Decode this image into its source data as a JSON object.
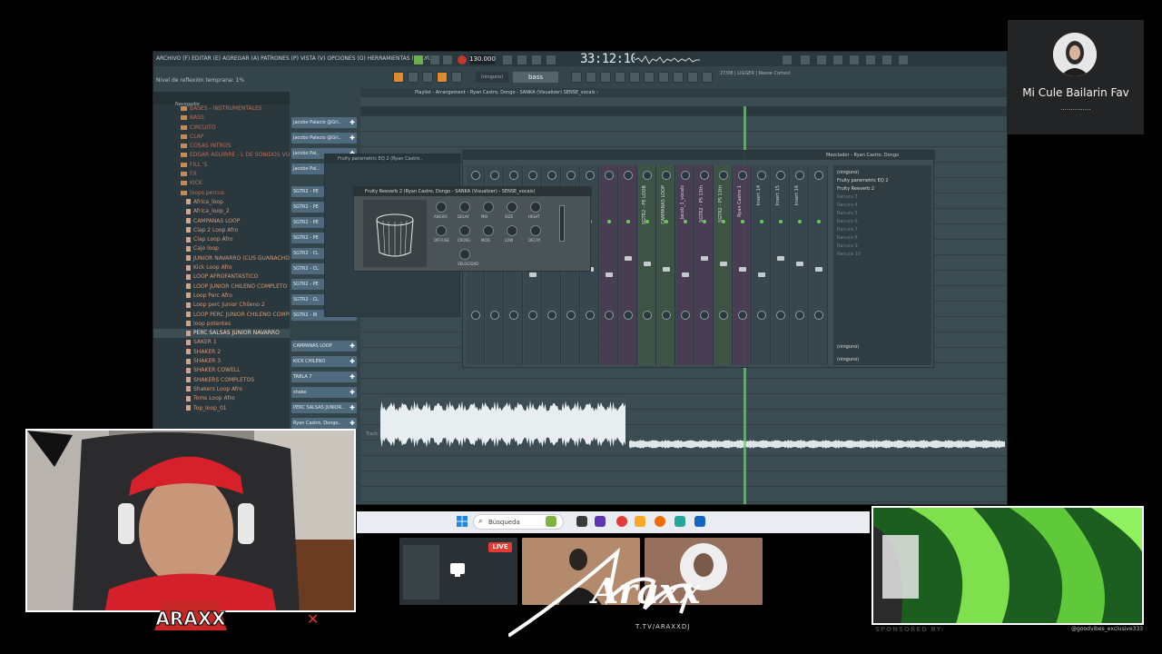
{
  "fl": {
    "menu": "ARCHIVO (F)  EDITAR (E)  AGREGAR (A)  PATRONES (P)  VISTA (V)  OPCIONES (O)  HERRAMIENTAS (T)  AYUDA",
    "tempo": "130.000",
    "time": "33:12:10",
    "hint": "Nivel de reflexión temprana: 1%",
    "pattern": "bass",
    "none_selector": "(ninguno)",
    "cpu_info": "27/08 | LIGGER | Reese\nCortest",
    "browser_tab": "Navegador",
    "browser_items": [
      {
        "label": "BASES - INSTRUMENTALES",
        "type": "folder"
      },
      {
        "label": "BASS",
        "type": "folder"
      },
      {
        "label": "CIRCUITO",
        "type": "folder"
      },
      {
        "label": "CLAP",
        "type": "folder"
      },
      {
        "label": "COSAS INTROS",
        "type": "folder"
      },
      {
        "label": "EDGAR AGUIRRE - L DE SONIDOS VOL 3",
        "type": "folder"
      },
      {
        "label": "FILL 'S",
        "type": "folder"
      },
      {
        "label": "FX",
        "type": "folder"
      },
      {
        "label": "KICK",
        "type": "folder"
      },
      {
        "label": "loops percus",
        "type": "folder"
      },
      {
        "label": "Africa_loop",
        "type": "file"
      },
      {
        "label": "Africa_loop_2",
        "type": "file"
      },
      {
        "label": "CAMPANAS LOOP",
        "type": "file"
      },
      {
        "label": "Clap 2 Loop Afro",
        "type": "file"
      },
      {
        "label": "Clap Loop Afro",
        "type": "file"
      },
      {
        "label": "Cajo loop",
        "type": "file"
      },
      {
        "label": "JUNIOR NAVARRO (CUS GUANACHOLES)",
        "type": "file"
      },
      {
        "label": "Kick Loop Afro",
        "type": "file"
      },
      {
        "label": "LOOP AFROFANTASTICO",
        "type": "file"
      },
      {
        "label": "LOOP JUNIOR CHILENO COMPLETO",
        "type": "file"
      },
      {
        "label": "Loop Perc Afro",
        "type": "file"
      },
      {
        "label": "Loop perc Junior Chileno 2",
        "type": "file"
      },
      {
        "label": "LOOP PERC JUNIOR CHILENO COMPLETO",
        "type": "file"
      },
      {
        "label": "loop potentes",
        "type": "file"
      },
      {
        "label": "PERC SALSAS JUNIOR NAVARRO",
        "type": "file",
        "selected": true
      },
      {
        "label": "SAKER 1",
        "type": "file"
      },
      {
        "label": "SHAKER 2",
        "type": "file"
      },
      {
        "label": "SHAKER 3",
        "type": "file"
      },
      {
        "label": "SHAKER COWELL",
        "type": "file"
      },
      {
        "label": "SHAKERS COMPLETOS",
        "type": "file"
      },
      {
        "label": "Shakers Loop Afro",
        "type": "file"
      },
      {
        "label": "Toms Loop Afro",
        "type": "file"
      },
      {
        "label": "Top_loop_01",
        "type": "file"
      }
    ],
    "channels": [
      "Jacobo Palacio @Gri..",
      "Jacobo Palacio @Gri..",
      "Jacobo Pal..",
      "Jacobo Pal..",
      "SGTR2 - PE",
      "SGTR2 - PE",
      "SGTR2 - PE",
      "SGTR2 - PE",
      "SGTR2 - CL",
      "SGTR2 - CL",
      "SGTR2 - PE",
      "SGTR2 - CL",
      "SGTR2 - RI",
      "CAMPANAS LOOP",
      "KICK CHILENO",
      "TABLA 7",
      "shake",
      "PERC SALSAS JUNIOR..",
      "Ryan Castro, Dongo.."
    ],
    "playlist_title": "Playlist - Arrangement › Ryan Castro, Dongo - SANKA (Visualizer)  SENSE_vocals ›",
    "track_label": "Track",
    "mixer": {
      "title": "Mezclador - Ryan Castro, Dongo",
      "strips": [
        "SGTR2 - PE LOOB",
        "CAMPANAS LOOP",
        "Jacob_1_vocals",
        "SGTR2 - PS 13th",
        "SGTR2 - PS 13th",
        "Ryan Castro 1",
        "Insert 14",
        "Insert 15",
        "Insert 16"
      ],
      "slots": [
        "(ninguno)",
        "Fruity parametric EQ 2",
        "Fruity Reeverb 2",
        "Ranura 3",
        "Ranura 4",
        "Ranura 5",
        "Ranura 6",
        "Ranura 7",
        "Ranura 8",
        "Ranura 9",
        "Ranura 10"
      ],
      "out_a": "(ninguno)",
      "out_b": "(ninguno)"
    },
    "reverb_title": "Fruity Reeverb 2 (Ryan Castro, Dongo - SANKA (Visualizer) - SENSE_vocals)",
    "eq_title": "Fruity parametric EQ 2 (Ryan Castro..",
    "reverb_labels": [
      "ANCHO",
      "DELAY",
      "MIX",
      "SIZE",
      "HIGHT",
      "DIFFUSE",
      "CROSS",
      "MOD",
      "LOW",
      "DECAY",
      "VELOCIDAD"
    ]
  },
  "taskbar": {
    "search_placeholder": "Búsqueda"
  },
  "guest": {
    "name": "Mi Cule Bailarin Fav",
    "sub": "..............."
  },
  "cards": {
    "live": "LIVE"
  },
  "branding": {
    "logo_text": "Araxx",
    "url": "T.TV/ARAXXDJ",
    "badge": "ARAXX",
    "sponsored": "SPONSORED BY:",
    "instagram": "@goodvibes_exclusive333"
  },
  "colors": {
    "fl_bg": "#34444b",
    "playhead": "#5bd65b",
    "live": "#e53935",
    "sponsor_green": "#2e7d32"
  }
}
